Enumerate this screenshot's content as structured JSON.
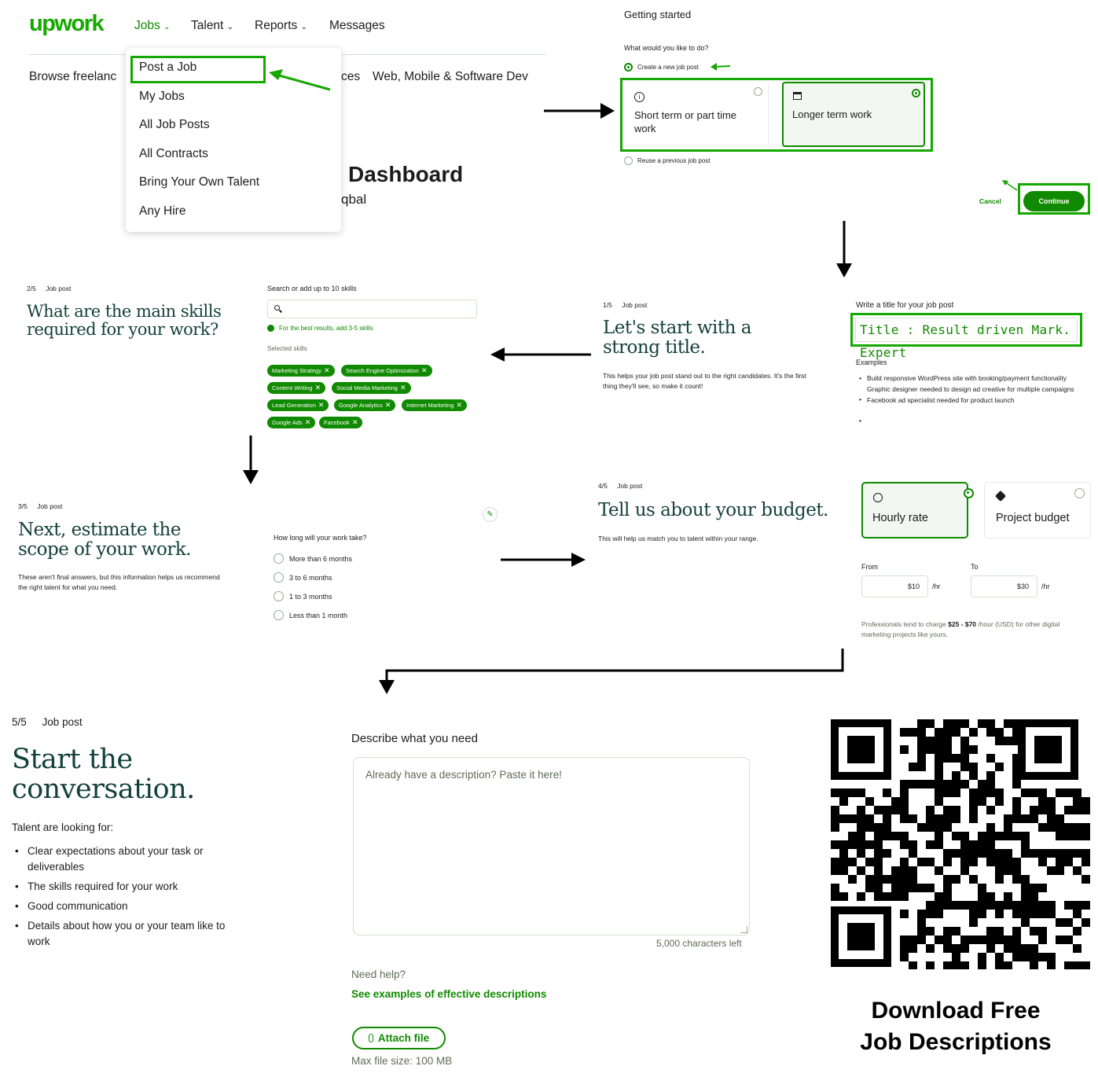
{
  "nav": {
    "logo": "upwork",
    "jobs": "Jobs",
    "talent": "Talent",
    "reports": "Reports",
    "messages": "Messages",
    "browse_partial": "Browse freelanc",
    "ces_partial": "ces",
    "web_dev": "Web, Mobile & Software Dev",
    "dashboard_partial": "Dashboard",
    "name_partial": "qbal"
  },
  "jobs_menu": {
    "items": [
      "Post a Job",
      "My Jobs",
      "All Job Posts",
      "All Contracts",
      "Bring Your Own Talent",
      "Any Hire"
    ]
  },
  "getting_started": {
    "title": "Getting started",
    "question": "What would you like to do?",
    "create_option": "Create a new job post",
    "short_term": "Short term or part time work",
    "longer_term": "Longer term work",
    "reuse_option": "Reuse a previous job post",
    "cancel": "Cancel",
    "continue": "Continue"
  },
  "step1": {
    "step": "1/5",
    "label": "Job post",
    "heading": "Let's start with a strong title.",
    "desc": "This helps your job post stand out to the right candidates. It's the first thing they'll see, so make it count!",
    "title_label": "Write a title for your job post",
    "title_value": "Title : Result driven Mark. Expert",
    "examples_label": "Examples",
    "examples": [
      "Build responsive WordPress site with booking/payment functionality",
      "Graphic designer needed to design ad creative for multiple campaigns",
      "Facebook ad specialist needed for product launch"
    ]
  },
  "step2": {
    "step": "2/5",
    "label": "Job post",
    "heading": "What are the main skills required for your work?",
    "search_label": "Search or add up to 10 skills",
    "hint": "For the best results, add 3-5 skills",
    "selected_label": "Selected skills",
    "skills": [
      "Marketing Strategy",
      "Search Engine Optimization",
      "Content Writing",
      "Social Media Marketing",
      "Lead Generation",
      "Google Analytics",
      "Internet Marketing",
      "Google Ads",
      "Facebook"
    ]
  },
  "step3": {
    "step": "3/5",
    "label": "Job post",
    "heading": "Next, estimate the scope of your work.",
    "desc": "These aren't final answers, but this information helps us recommend the right talent for what you need.",
    "question": "How long will your work take?",
    "options": [
      "More than 6 months",
      "3 to 6 months",
      "1 to 3 months",
      "Less than 1 month"
    ]
  },
  "step4": {
    "step": "4/5",
    "label": "Job post",
    "heading": "Tell us about your budget.",
    "desc": "This will help us match you to talent within your range.",
    "hourly": "Hourly rate",
    "project": "Project budget",
    "from_label": "From",
    "to_label": "To",
    "from_value": "$10",
    "to_value": "$30",
    "per_hr": "/hr",
    "note_pre": "Professionals tend to charge",
    "note_range": "$25 - $70",
    "note_post": "/hour (USD) for other digital marketing projects like yours."
  },
  "step5": {
    "step": "5/5",
    "label": "Job post",
    "heading": "Start the conversation.",
    "looking_for": "Talent are looking for:",
    "bullets": [
      "Clear expectations about your task or deliverables",
      "The skills required for your work",
      "Good communication",
      "Details about how you or your team like to work"
    ],
    "describe_label": "Describe what you need",
    "placeholder": "Already have a description? Paste it here!",
    "chars_left": "5,000 characters left",
    "need_help": "Need help?",
    "examples_link": "See examples of effective descriptions",
    "attach": "Attach file",
    "max_size": "Max file size: 100 MB"
  },
  "promo": {
    "line1": "Download Free",
    "line2": "Job Descriptions"
  },
  "colors": {
    "brand_green": "#108a00",
    "heading_teal": "#14403c",
    "highlight_green": "#14a800"
  }
}
